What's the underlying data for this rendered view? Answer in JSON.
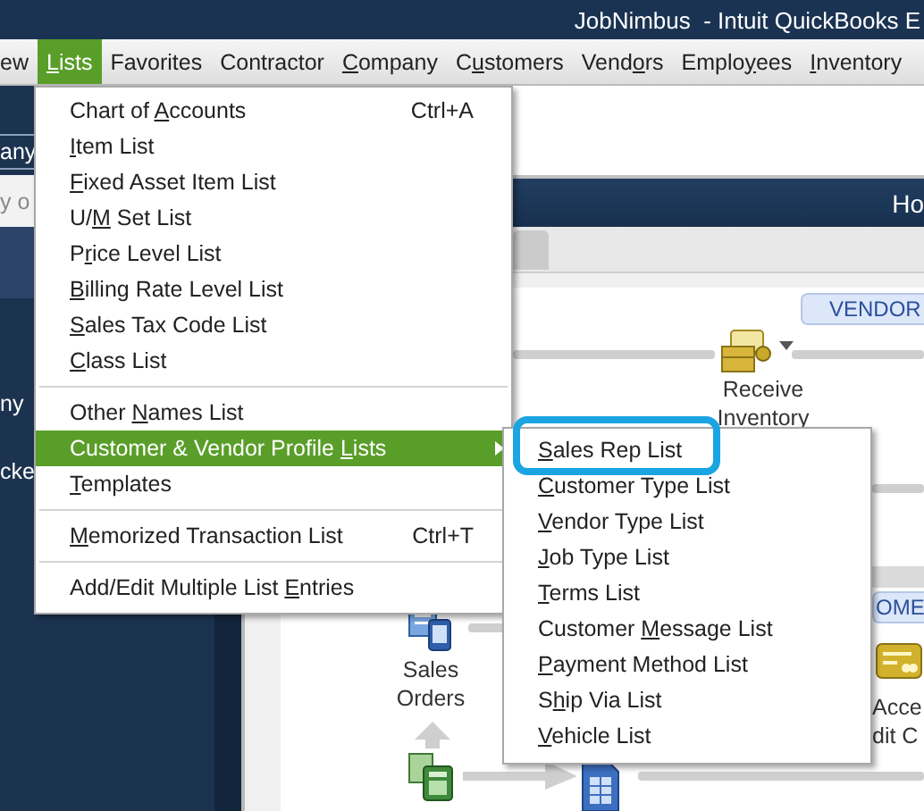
{
  "window": {
    "title": "JobNimbus  - Intuit QuickBooks E"
  },
  "menubar": [
    {
      "before": "ew",
      "selected": false
    },
    {
      "accel": "L",
      "after": "ists",
      "selected": true
    },
    {
      "before": "Favorites",
      "selected": false
    },
    {
      "before": "Contractor",
      "selected": false
    },
    {
      "accel": "C",
      "after": "ompany",
      "selected": false
    },
    {
      "before": "C",
      "accel": "u",
      "after": "stomers",
      "selected": false
    },
    {
      "before": "Vend",
      "accel": "o",
      "after": "rs",
      "selected": false
    },
    {
      "before": "Emplo",
      "accel": "y",
      "after": "ees",
      "selected": false
    },
    {
      "accel": "I",
      "after": "nventory",
      "selected": false
    }
  ],
  "sidebar": {
    "tab": "any",
    "search_placeholder": "y o",
    "items": [
      "ny",
      "cke"
    ]
  },
  "home": {
    "header": "Ho",
    "vendors_tab": "VENDOR",
    "receive_label": [
      "Receive",
      "Inventory"
    ],
    "customers_tab": "OME",
    "accept_label": [
      "Acce",
      "dit C"
    ],
    "sales_orders_label": [
      "Sales",
      "Orders"
    ]
  },
  "lists_menu": [
    {
      "kind": "item",
      "before": "Chart of ",
      "accel": "A",
      "after": "ccounts",
      "shortcut": "Ctrl+A",
      "selected": false
    },
    {
      "kind": "item",
      "accel": "I",
      "after": "tem List",
      "selected": false
    },
    {
      "kind": "item",
      "accel": "F",
      "after": "ixed Asset Item List",
      "selected": false
    },
    {
      "kind": "item",
      "before": "U/",
      "accel": "M",
      "after": " Set List",
      "selected": false
    },
    {
      "kind": "item",
      "before": "P",
      "accel": "r",
      "after": "ice Level List",
      "selected": false
    },
    {
      "kind": "item",
      "accel": "B",
      "after": "illing Rate Level List",
      "selected": false
    },
    {
      "kind": "item",
      "accel": "S",
      "after": "ales Tax Code List",
      "selected": false
    },
    {
      "kind": "item",
      "accel": "C",
      "after": "lass List",
      "selected": false
    },
    {
      "kind": "separator"
    },
    {
      "kind": "item",
      "before": "Other ",
      "accel": "N",
      "after": "ames List",
      "selected": false
    },
    {
      "kind": "submenu",
      "before": "Customer & Vendor Profile ",
      "accel": "L",
      "after": "ists",
      "selected": true
    },
    {
      "kind": "item",
      "accel": "T",
      "after": "emplates",
      "selected": false
    },
    {
      "kind": "separator"
    },
    {
      "kind": "item",
      "accel": "M",
      "after": "emorized Transaction List",
      "shortcut": "Ctrl+T",
      "selected": false
    },
    {
      "kind": "separator"
    },
    {
      "kind": "item",
      "before": "Add/Edit Multiple List ",
      "accel": "E",
      "after": "ntries",
      "selected": false
    }
  ],
  "profile_submenu": [
    {
      "accel": "S",
      "after": "ales Rep List",
      "highlighted": true
    },
    {
      "accel": "C",
      "after": "ustomer Type List",
      "highlighted": false
    },
    {
      "accel": "V",
      "after": "endor Type List",
      "highlighted": false
    },
    {
      "accel": "J",
      "after": "ob Type List",
      "highlighted": false
    },
    {
      "accel": "T",
      "after": "erms List",
      "highlighted": false
    },
    {
      "before": "Customer ",
      "accel": "M",
      "after": "essage List",
      "highlighted": false
    },
    {
      "accel": "P",
      "after": "ayment Method List",
      "highlighted": false
    },
    {
      "before": "S",
      "accel": "h",
      "after": "ip Via List",
      "highlighted": false
    },
    {
      "accel": "V",
      "after": "ehicle List",
      "highlighted": false
    }
  ]
}
